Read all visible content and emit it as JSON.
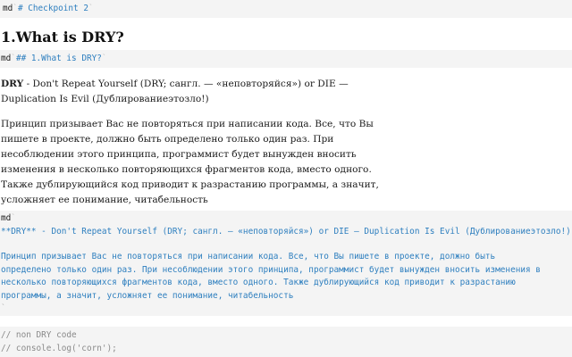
{
  "cell1": {
    "prefix": "md",
    "tick": "`",
    "code": "# Checkpoint 2",
    "tick_end": "`"
  },
  "heading": {
    "text": "1.What is DRY?"
  },
  "cell2": {
    "prefix": "md",
    "tick": "`",
    "code": "## 1.What is DRY?",
    "tick_end": "`"
  },
  "paragraph1": {
    "bold": "DRY",
    "rest": " - Don't Repeat Yourself (DRY; сангл. — «неповторяйся») or DIE — Duplication Is Evil (Дублированиеэтозло!)"
  },
  "paragraph2": {
    "text": "Принцип призывает Вас не повторяться при написании кода. Все, что Вы пишете в проекте, должно быть определено только один раз. При несоблюдении этого принципа, программист будет вынужден вносить изменения в несколько повторяющихся фрагментов кода, вместо одного. Также дублирующийся код приводит к разрастанию программы, а значит, усложняет ее понимание, читабельность"
  },
  "cell3": {
    "prefix": "md",
    "tick": "`",
    "line1": "**DRY** - Don't Repeat Yourself (DRY; сангл. — «неповторяйся») or DIE — Duplication Is Evil (Дублированиеэтозло!)",
    "line2": "Принцип призывает Вас не повторяться при написании кода. Все, что Вы пишете в проекте, должно быть определено только один раз. При несоблюдении этого принципа, программист будет вынужден вносить изменения в несколько повторяющихся фрагментов кода, вместо одного. Также дублирующийся код приводит к разрастанию программы, а значит, усложняет ее понимание, читабельность",
    "tick_end": "`"
  },
  "cell4": {
    "line1": "// non DRY code",
    "line2": "// console.log('corn');"
  }
}
